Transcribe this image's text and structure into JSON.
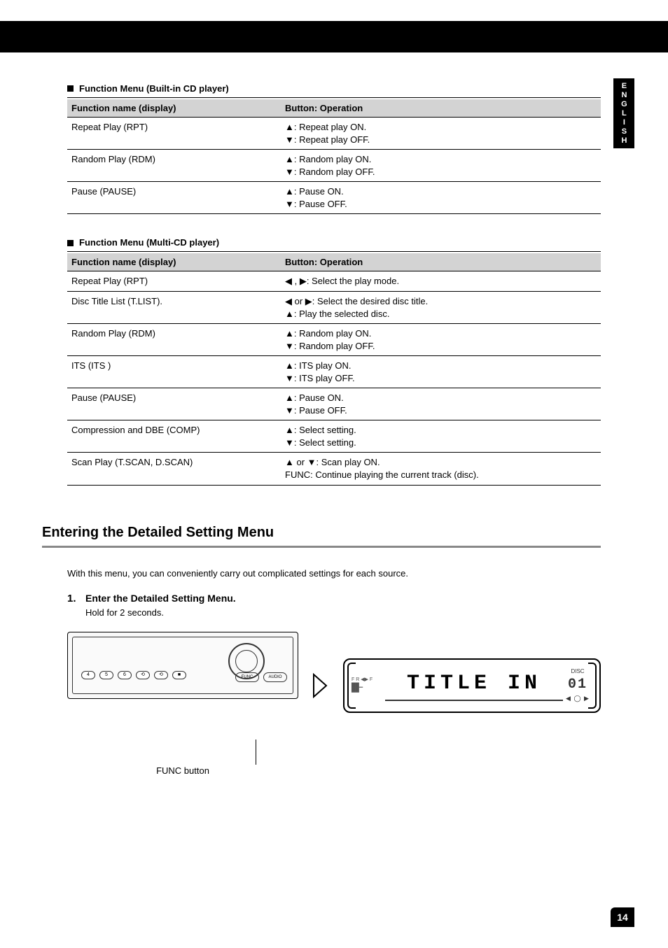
{
  "language_tab": "ENGLISH",
  "section_a": {
    "title": "Function Menu (Built-in CD player)",
    "header1": "Function name (display)",
    "header2": "Button: Operation",
    "rows": [
      {
        "name": "Repeat Play (RPT)",
        "ops": [
          "▲: Repeat play ON.",
          "▼: Repeat play OFF."
        ]
      },
      {
        "name": "Random Play (RDM)",
        "ops": [
          "▲: Random play ON.",
          "▼: Random play OFF."
        ]
      },
      {
        "name": "Pause (PAUSE)",
        "ops": [
          "▲: Pause ON.",
          "▼: Pause OFF."
        ]
      }
    ]
  },
  "section_b": {
    "title": "Function Menu (Multi-CD player)",
    "header1": "Function name (display)",
    "header2": "Button: Operation",
    "rows": [
      {
        "name": "Repeat Play (RPT)",
        "ops": [
          "◀ , ▶: Select the play mode."
        ]
      },
      {
        "name": "Disc Title List (T.LIST).",
        "ops": [
          "◀ or ▶: Select the desired disc title.",
          "▲: Play the selected disc."
        ]
      },
      {
        "name": "Random Play (RDM)",
        "ops": [
          "▲: Random play ON.",
          "▼: Random play OFF."
        ]
      },
      {
        "name": "ITS (ITS )",
        "ops": [
          "▲: ITS play ON.",
          "▼: ITS play OFF."
        ]
      },
      {
        "name": "Pause (PAUSE)",
        "ops": [
          "▲: Pause ON.",
          "▼: Pause OFF."
        ]
      },
      {
        "name": "Compression and DBE (COMP)",
        "ops": [
          "▲: Select setting.",
          "▼: Select setting."
        ]
      },
      {
        "name": "Scan Play (T.SCAN, D.SCAN)",
        "ops": [
          "▲ or ▼: Scan play ON.",
          "FUNC: Continue playing the current track (disc)."
        ]
      }
    ]
  },
  "heading": "Entering the Detailed Setting Menu",
  "description": "With this menu, you can conveniently carry out complicated settings for each source.",
  "step1": {
    "num": "1.",
    "text": "Enter the Detailed Setting Menu.",
    "sub": "Hold for 2 seconds.",
    "button_label": "FUNC button",
    "lcd_text": "TITLE IN",
    "disc_label": "DISC",
    "disc_num": "01",
    "btn_func": "FUNC",
    "btn_audio": "AUDIO",
    "btns": [
      "4",
      "5",
      "6",
      "",
      "",
      ""
    ]
  },
  "page_number": "14"
}
